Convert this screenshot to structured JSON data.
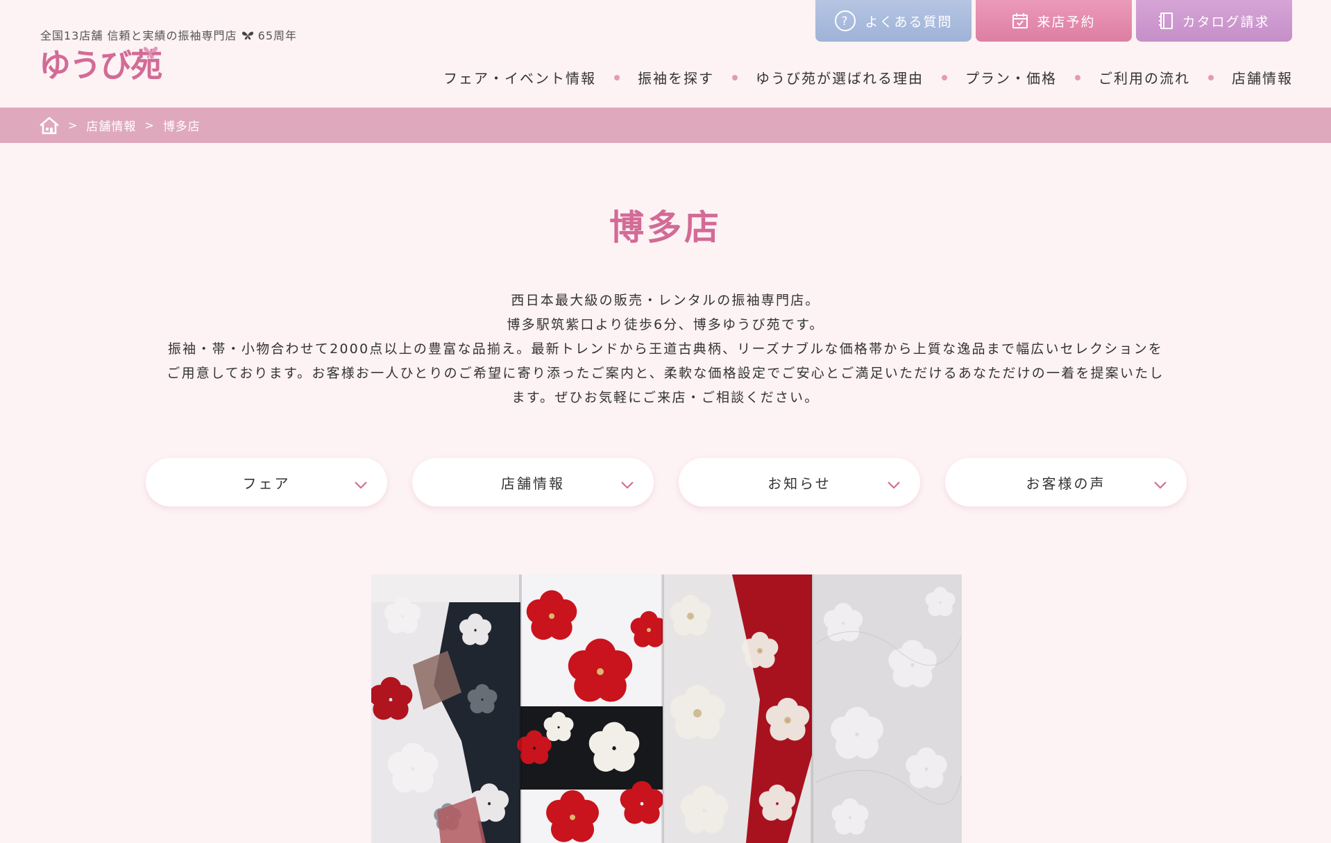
{
  "header": {
    "tagline": "全国13店舗 信頼と実績の振袖専門店",
    "tagline_suffix": "65周年",
    "logo_text": "ゆうび苑",
    "top_buttons": [
      {
        "label": "よくある質問",
        "icon": "question-circle-icon",
        "color": "#a9bce0"
      },
      {
        "label": "来店予約",
        "icon": "calendar-icon",
        "color": "#e58cae"
      },
      {
        "label": "カタログ請求",
        "icon": "catalog-book-icon",
        "color": "#cc98ce"
      }
    ],
    "nav": [
      {
        "label": "フェア・イベント情報"
      },
      {
        "label": "振袖を探す"
      },
      {
        "label": "ゆうび苑が選ばれる理由"
      },
      {
        "label": "プラン・価格"
      },
      {
        "label": "ご利用の流れ"
      },
      {
        "label": "店舗情報"
      }
    ]
  },
  "breadcrumb": {
    "home_icon": "home-icon",
    "items": [
      "店舗情報",
      "博多店"
    ]
  },
  "main": {
    "title": "博多店",
    "intro": [
      "西日本最大級の販売・レンタルの振袖専門店。",
      "博多駅筑紫口より徒歩6分、博多ゆうび苑です。",
      "振袖・帯・小物合わせて2000点以上の豊富な品揃え。最新トレンドから王道古典柄、リーズナブルな価格帯から上質な逸品まで幅広いセレクションを",
      "ご用意しております。お客様お一人ひとりのご希望に寄り添ったご案内と、柔軟な価格設定でご安心とご満足いただけるあなただけの一着を提案いたし",
      "ます。ぜひお気軽にご来店・ご相談ください。"
    ],
    "subnav": [
      {
        "label": "フェア"
      },
      {
        "label": "店舗情報"
      },
      {
        "label": "お知らせ"
      },
      {
        "label": "お客様の声"
      }
    ]
  },
  "colors": {
    "background": "#fdf2f4",
    "accent": "#d26b96",
    "breadcrumb_bar": "#dfa8bd",
    "nav_dot": "#e59ab7"
  }
}
